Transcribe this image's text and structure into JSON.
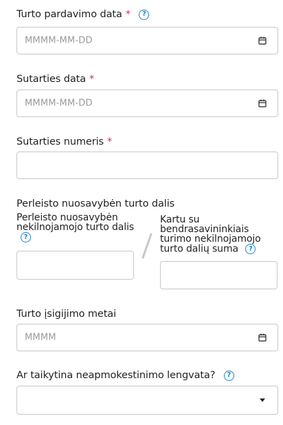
{
  "sale_date": {
    "label": "Turto pardavimo data",
    "required_mark": "*",
    "placeholder": "MMMM-MM-DD"
  },
  "contract_date": {
    "label": "Sutarties data",
    "required_mark": "*",
    "placeholder": "MMMM-MM-DD"
  },
  "contract_number": {
    "label": "Sutarties numeris",
    "required_mark": "*",
    "value": ""
  },
  "share": {
    "title": "Perleisto nuosavybėn turto dalis",
    "part_label": "Perleisto nuosavybėn nekilnojamojo turto dalis",
    "total_label": "Kartu su bendrasavininkiais turimo nekilnojamojo turto dalių suma",
    "separator": "/"
  },
  "acquisition_year": {
    "label": "Turto įsigijimo metai",
    "placeholder": "MMMM"
  },
  "tax_exemption": {
    "label": "Ar taikytina neapmokestinimo lengvata?",
    "selected": ""
  },
  "icons": {
    "help": "question-circle-icon",
    "calendar": "calendar-icon",
    "dropdown": "caret-down-icon"
  },
  "colors": {
    "accent": "#1c84c6",
    "required": "#e0245e",
    "border": "#c8c8c8"
  }
}
